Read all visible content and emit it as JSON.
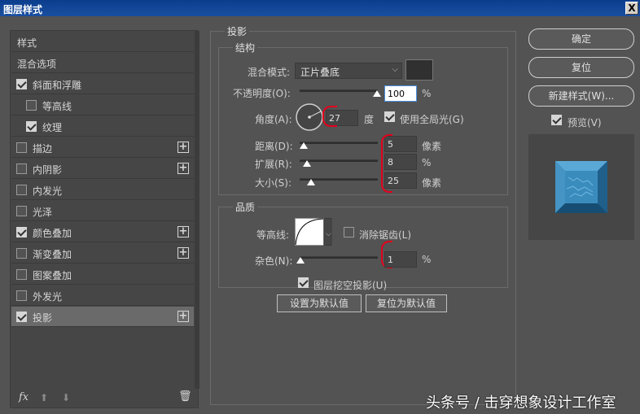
{
  "window": {
    "title": "图层样式",
    "close_glyph": "X"
  },
  "styles_list": {
    "items": [
      {
        "label": "样式",
        "has_checkbox": false,
        "checked": false,
        "plus": false,
        "indent": 0
      },
      {
        "label": "混合选项",
        "has_checkbox": false,
        "checked": false,
        "plus": false,
        "indent": 0
      },
      {
        "label": "斜面和浮雕",
        "has_checkbox": true,
        "checked": true,
        "plus": false,
        "indent": 0
      },
      {
        "label": "等高线",
        "has_checkbox": true,
        "checked": false,
        "plus": false,
        "indent": 1
      },
      {
        "label": "纹理",
        "has_checkbox": true,
        "checked": true,
        "plus": false,
        "indent": 1
      },
      {
        "label": "描边",
        "has_checkbox": true,
        "checked": false,
        "plus": true,
        "indent": 0
      },
      {
        "label": "内阴影",
        "has_checkbox": true,
        "checked": false,
        "plus": true,
        "indent": 0
      },
      {
        "label": "内发光",
        "has_checkbox": true,
        "checked": false,
        "plus": false,
        "indent": 0
      },
      {
        "label": "光泽",
        "has_checkbox": true,
        "checked": false,
        "plus": false,
        "indent": 0
      },
      {
        "label": "颜色叠加",
        "has_checkbox": true,
        "checked": true,
        "plus": true,
        "indent": 0
      },
      {
        "label": "渐变叠加",
        "has_checkbox": true,
        "checked": false,
        "plus": true,
        "indent": 0
      },
      {
        "label": "图案叠加",
        "has_checkbox": true,
        "checked": false,
        "plus": false,
        "indent": 0
      },
      {
        "label": "外发光",
        "has_checkbox": true,
        "checked": false,
        "plus": false,
        "indent": 0
      },
      {
        "label": "投影",
        "has_checkbox": true,
        "checked": true,
        "plus": true,
        "indent": 0,
        "selected": true
      }
    ],
    "bottom": {
      "fx_label": "fx",
      "up_glyph": "⬆",
      "down_glyph": "⬇",
      "trash_glyph": "🗑"
    }
  },
  "drop_shadow": {
    "section_title": "投影",
    "structure": {
      "title": "结构",
      "blend_mode_label": "混合模式:",
      "blend_mode_value": "正片叠底",
      "opacity_label": "不透明度(O):",
      "opacity_value": "100",
      "opacity_unit": "%",
      "opacity_pct": 100,
      "angle_label": "角度(A):",
      "angle_value": "27",
      "angle_unit": "度",
      "global_light_label": "使用全局光(G)",
      "global_light_checked": true,
      "distance_label": "距离(D):",
      "distance_value": "5",
      "distance_unit": "像素",
      "spread_label": "扩展(R):",
      "spread_value": "8",
      "spread_unit": "%",
      "size_label": "大小(S):",
      "size_value": "25",
      "size_unit": "像素"
    },
    "quality": {
      "title": "品质",
      "contour_label": "等高线:",
      "anti_alias_label": "消除锯齿(L)",
      "anti_alias_checked": false,
      "noise_label": "杂色(N):",
      "noise_value": "1",
      "noise_unit": "%"
    },
    "knockout_label": "图层挖空投影(U)",
    "knockout_checked": true,
    "make_default_label": "设置为默认值",
    "reset_default_label": "复位为默认值"
  },
  "buttons": {
    "ok": "确定",
    "reset": "复位",
    "new_style": "新建样式(W)...",
    "preview_label": "预览(V)",
    "preview_checked": true
  },
  "watermark": "头条号 / 击穿想象设计工作室",
  "colors": {
    "preview_tile": "#2f7fb0",
    "accent_annotation": "#e3001b"
  }
}
